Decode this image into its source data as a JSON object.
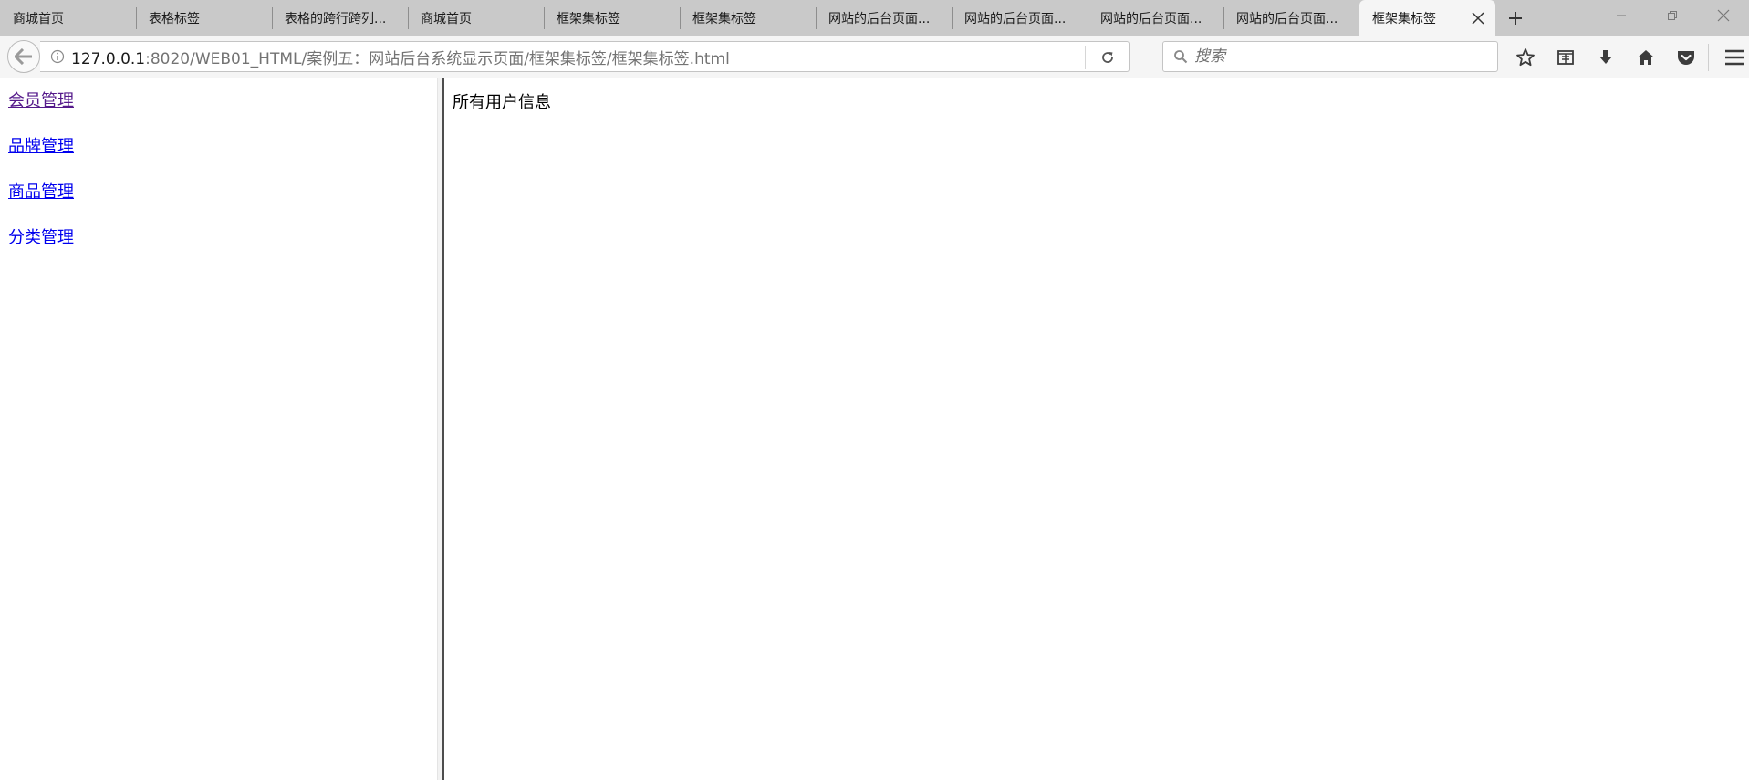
{
  "browser": {
    "tabs": [
      {
        "label": "商城首页",
        "active": false
      },
      {
        "label": "表格标签",
        "active": false
      },
      {
        "label": "表格的跨行跨列...",
        "active": false
      },
      {
        "label": "商城首页",
        "active": false
      },
      {
        "label": "框架集标签",
        "active": false
      },
      {
        "label": "框架集标签",
        "active": false
      },
      {
        "label": "网站的后台页面...",
        "active": false
      },
      {
        "label": "网站的后台页面...",
        "active": false
      },
      {
        "label": "网站的后台页面...",
        "active": false
      },
      {
        "label": "网站的后台页面...",
        "active": false
      },
      {
        "label": "框架集标签",
        "active": true
      }
    ],
    "url_host": "127.0.0.1",
    "url_rest": ":8020/WEB01_HTML/案例五：网站后台系统显示页面/框架集标签/框架集标签.html",
    "search_placeholder": "搜索",
    "icons": {
      "back": "back-arrow-icon",
      "info": "info-icon",
      "reload": "reload-icon",
      "search": "search-icon",
      "bookmark": "bookmark-star-icon",
      "reader": "reader-view-icon",
      "download": "download-icon",
      "home": "home-icon",
      "pocket": "pocket-icon",
      "menu": "hamburger-menu-icon"
    }
  },
  "left_frame": {
    "links": [
      {
        "label": "会员管理",
        "visited": true
      },
      {
        "label": "品牌管理",
        "visited": false
      },
      {
        "label": "商品管理",
        "visited": false
      },
      {
        "label": "分类管理",
        "visited": false
      }
    ]
  },
  "right_frame": {
    "text": "所有用户信息"
  },
  "colors": {
    "link": "#0000ee",
    "visited_link": "#551a8b",
    "tabstrip": "#c9c9c9",
    "toolbar": "#f5f5f5"
  }
}
